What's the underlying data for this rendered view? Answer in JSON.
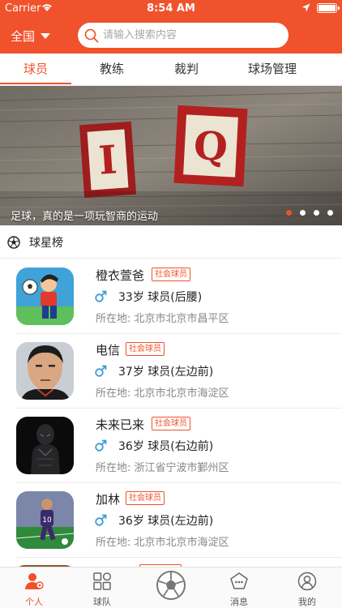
{
  "status_bar": {
    "carrier": "Carrier",
    "time": "8:54 AM"
  },
  "header": {
    "region_label": "全国",
    "search_placeholder": "请输入搜索内容"
  },
  "tabs": [
    {
      "label": "球员",
      "active": true
    },
    {
      "label": "教练",
      "active": false
    },
    {
      "label": "裁判",
      "active": false
    },
    {
      "label": "球场管理",
      "active": false
    }
  ],
  "banner": {
    "block_letters": [
      "I",
      "Q"
    ],
    "caption": "足球，真的是一项玩智商的运动",
    "slide_count": 4,
    "active_slide": 1
  },
  "section": {
    "title": "球星榜"
  },
  "players": [
    {
      "name": "橙衣萱爸",
      "badge": "社会球员",
      "meta": "33岁 球员(后腰)",
      "location": "所在地:  北京市北京市昌平区"
    },
    {
      "name": "电信",
      "badge": "社会球员",
      "meta": "37岁 球员(左边前)",
      "location": "所在地:  北京市北京市海淀区"
    },
    {
      "name": "未来已来",
      "badge": "社会球员",
      "meta": "36岁 球员(右边前)",
      "location": "所在地:  浙江省宁波市鄞州区"
    },
    {
      "name": "加林",
      "badge": "社会球员",
      "meta": "36岁 球员(左边前)",
      "location": "所在地:  北京市北京市海淀区"
    }
  ],
  "colors": {
    "brand": "#f0522b",
    "male_symbol": "#3a9bd9"
  },
  "tabbar": {
    "personal": "个人",
    "team": "球队",
    "messages": "消息",
    "mine": "我的",
    "active": "personal"
  }
}
